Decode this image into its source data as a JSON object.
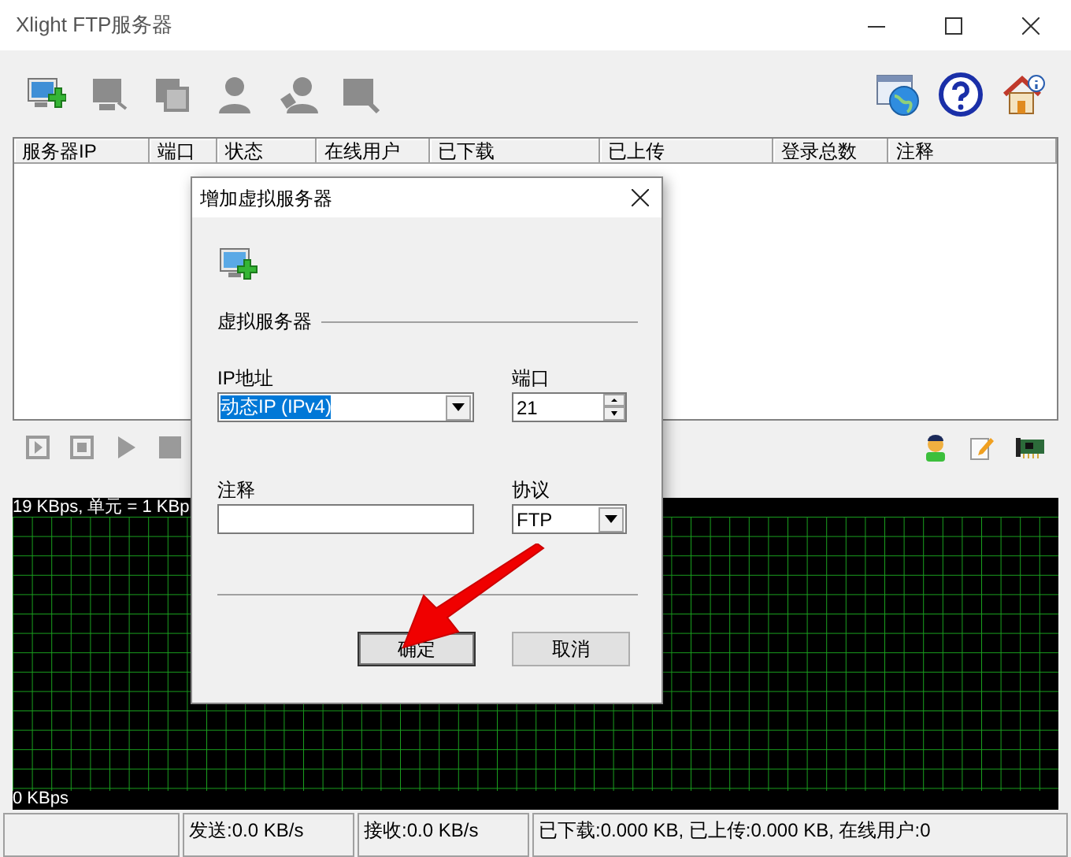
{
  "window": {
    "title": "Xlight FTP服务器"
  },
  "toolbar": [
    {
      "kind": "add-server",
      "disabled": false
    },
    {
      "kind": "server",
      "disabled": true
    },
    {
      "kind": "copy",
      "disabled": true
    },
    {
      "kind": "user",
      "disabled": true
    },
    {
      "kind": "users",
      "disabled": true
    },
    {
      "kind": "window",
      "disabled": true
    }
  ],
  "table": {
    "columns": [
      "服务器IP",
      "端口",
      "状态",
      "在线用户",
      "已下载",
      "已上传",
      "登录总数",
      "注释"
    ]
  },
  "controls": [
    {
      "kind": "step",
      "disabled": true
    },
    {
      "kind": "stop",
      "disabled": true
    },
    {
      "kind": "play",
      "disabled": true
    },
    {
      "kind": "halt",
      "disabled": true
    }
  ],
  "graph": {
    "scale_label": "19 KBps, 单元 = 1 KBp",
    "bottom_label": "0 KBps"
  },
  "status_bar": [
    "发送:0.0 KB/s",
    "接收:0.0 KB/s",
    "已下载:0.000 KB, 已上传:0.000 KB, 在线用户:0"
  ],
  "dialog": {
    "title": "增加虚拟服务器",
    "section": "虚拟服务器",
    "ip": {
      "label": "IP地址",
      "value": "动态IP (IPv4)"
    },
    "port": {
      "label": "端口",
      "value": "21"
    },
    "note": {
      "label": "注释"
    },
    "protocol": {
      "label": "协议",
      "value": "FTP"
    },
    "buttons": [
      "确定",
      "取消"
    ]
  }
}
